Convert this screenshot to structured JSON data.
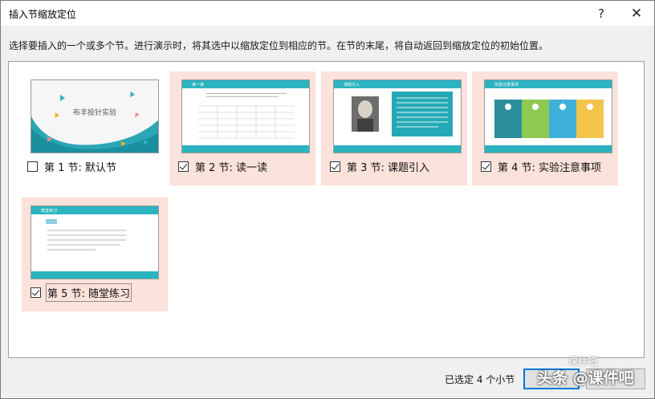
{
  "window": {
    "title": "插入节缩放定位",
    "help_glyph": "?",
    "close_glyph": "✕"
  },
  "instruction": "选择要插入的一个或多个节。进行演示时，将其选中以缩放定位到相应的节。在节的末尾，将自动返回到缩放定位的初始位置。",
  "sections": [
    {
      "label": "第 1 节: 默认节",
      "checked": false,
      "slide_title": "布丰投针实验"
    },
    {
      "label": "第 2 节: 读一读",
      "checked": true,
      "slide_header": "读一读"
    },
    {
      "label": "第 3 节: 课题引入",
      "checked": true,
      "slide_header": "课题引入"
    },
    {
      "label": "第 4 节: 实验注意事项",
      "checked": true,
      "slide_header": "实验注意事项"
    },
    {
      "label": "第 5 节: 随堂练习",
      "checked": true,
      "slide_header": "随堂练习"
    }
  ],
  "footer": {
    "status": "已选定 4 个小节"
  },
  "watermark": {
    "text": "头条 @课件吧",
    "sub": "课件吧"
  },
  "colors": {
    "selected_bg": "#fbe2da",
    "accent": "#0078d7",
    "slide_teal": "#2bb3c0"
  }
}
